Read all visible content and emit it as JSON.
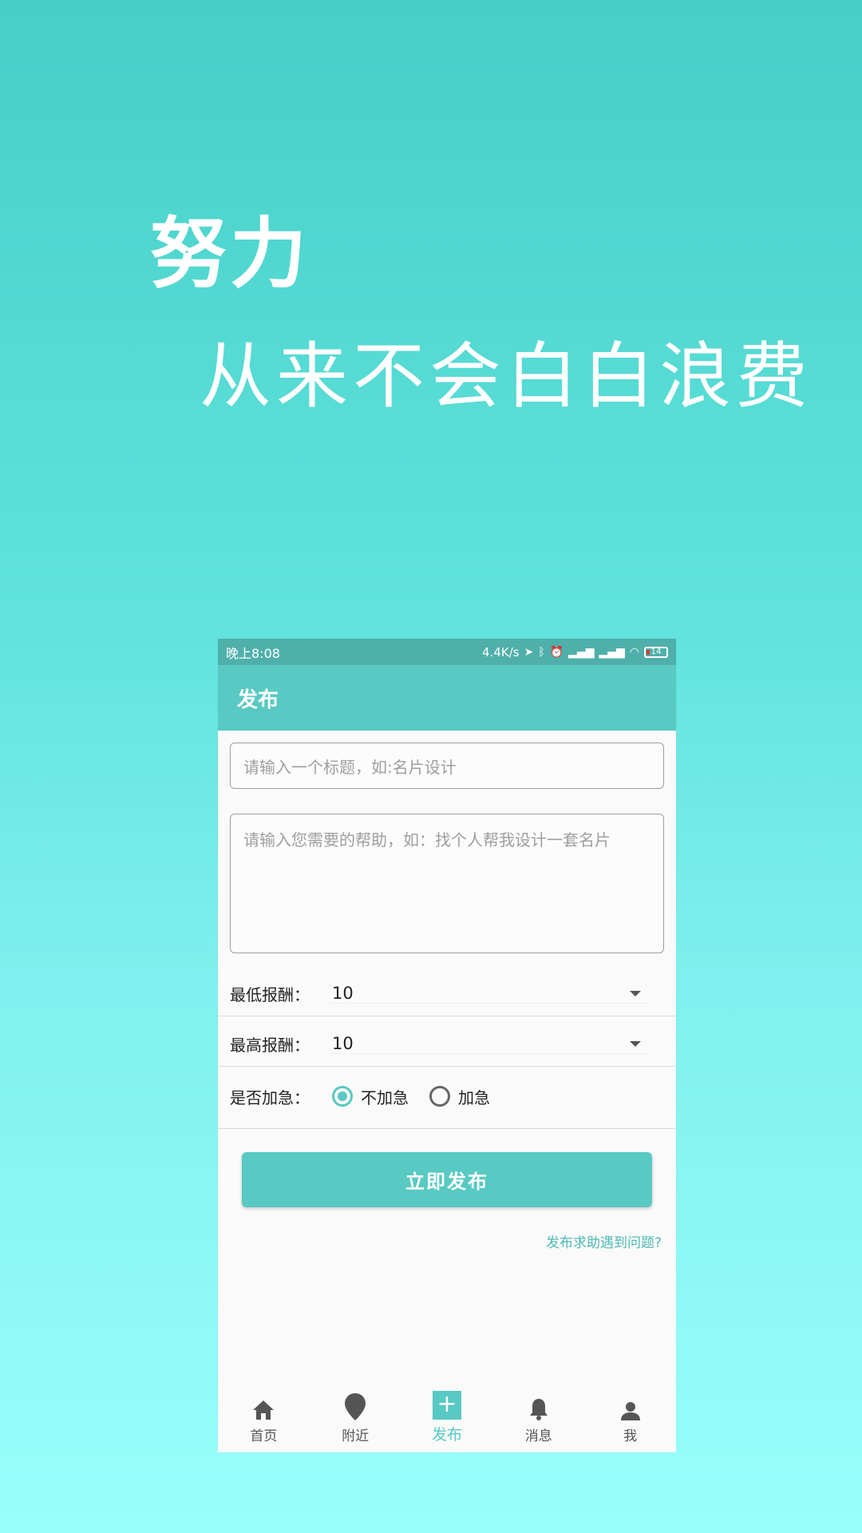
{
  "slogan": {
    "line1": "努力",
    "line2": "从来不会白白浪费"
  },
  "status_bar": {
    "time": "晚上8:08",
    "speed": "4.4K/s",
    "battery": "14"
  },
  "app_bar": {
    "title": "发布"
  },
  "form": {
    "title_placeholder": "请输入一个标题，如:名片设计",
    "desc_placeholder": "请输入您需要的帮助，如：找个人帮我设计一套名片",
    "min_reward": {
      "label": "最低报酬：",
      "value": "10"
    },
    "max_reward": {
      "label": "最高报酬：",
      "value": "10"
    },
    "urgent": {
      "label": "是否加急：",
      "option_no": "不加急",
      "option_yes": "加急",
      "selected": "不加急"
    },
    "submit_label": "立即发布",
    "help_link": "发布求助遇到问题?"
  },
  "tabs": [
    {
      "label": "首页",
      "icon": "home-icon"
    },
    {
      "label": "附近",
      "icon": "location-pin-icon"
    },
    {
      "label": "发布",
      "icon": "plus-icon",
      "active": true
    },
    {
      "label": "消息",
      "icon": "bell-icon"
    },
    {
      "label": "我",
      "icon": "person-icon"
    }
  ],
  "colors": {
    "accent": "#58C9C3",
    "status_bar": "#4FB0AB"
  }
}
